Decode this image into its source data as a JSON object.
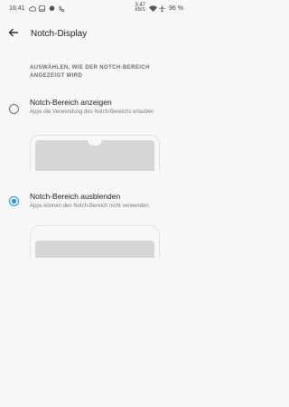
{
  "status_bar": {
    "time": "16:41",
    "speed_value": "3,47",
    "speed_unit": "KB/S",
    "battery": "96 %"
  },
  "app_bar": {
    "back_icon": "arrow-back-icon",
    "title": "Notch-Display"
  },
  "section_header": "AUSWÄHLEN, WIE DER NOTCH-BEREICH ANGEZEIGT WIRD",
  "options": [
    {
      "title": "Notch-Bereich anzeigen",
      "description": "Apps die Verwendung des Notch-Bereichs erlauben",
      "selected": false
    },
    {
      "title": "Notch-Bereich ausblenden",
      "description": "Apps können den Notch-Bereich nicht verwenden",
      "selected": true
    }
  ],
  "colors": {
    "accent": "#2196f3",
    "background": "#f7f7f7",
    "preview_screen": "#d6d6d6"
  }
}
